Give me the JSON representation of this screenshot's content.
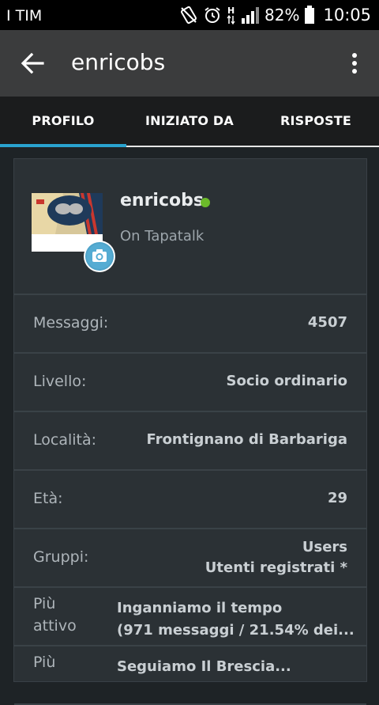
{
  "statusbar": {
    "carrier": "I TIM",
    "battery": "82%",
    "time": "10:05"
  },
  "appbar": {
    "title": "enricobs"
  },
  "tabs": [
    {
      "label": "PROFILO",
      "active": true
    },
    {
      "label": "INIZIATO DA",
      "active": false
    },
    {
      "label": "RISPOSTE",
      "active": false
    }
  ],
  "profile": {
    "username": "enricobs",
    "subtitle": "On Tapatalk",
    "status_color": "#6cba2a"
  },
  "details": {
    "messages": {
      "label": "Messaggi:",
      "value": "4507"
    },
    "level": {
      "label": "Livello:",
      "value": "Socio ordinario"
    },
    "location": {
      "label": "Località:",
      "value": "Frontignano di Barbariga"
    },
    "age": {
      "label": "Età:",
      "value": "29"
    },
    "groups": {
      "label": "Gruppi:",
      "values": [
        "Users",
        "Utenti registrati *"
      ]
    },
    "most_active_in": {
      "label": "Più attivo nel",
      "value_line1": "Inganniamo il tempo",
      "value_line2": "(971 messaggi / 21.54% dei..."
    },
    "most_active_topic": {
      "label": "Più",
      "value_line1": "Seguiamo Il Brescia..."
    }
  },
  "colors": {
    "accent": "#2aa3cf",
    "appbar": "#3b3c3d",
    "card": "#2b3135"
  }
}
